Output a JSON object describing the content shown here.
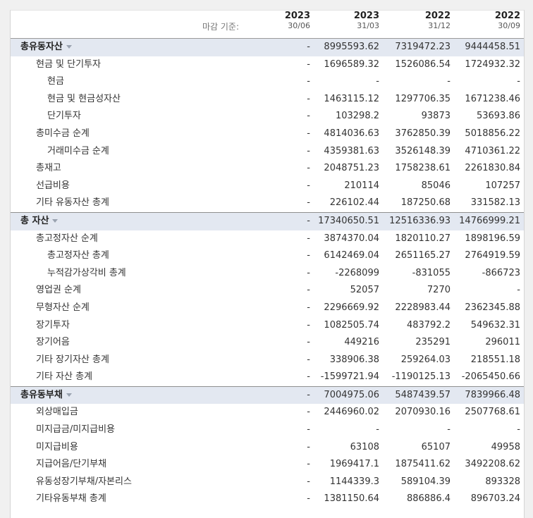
{
  "header": {
    "basis_label": "마감 기준:",
    "columns": [
      {
        "year": "2023",
        "date": "30/06"
      },
      {
        "year": "2023",
        "date": "31/03"
      },
      {
        "year": "2022",
        "date": "31/12"
      },
      {
        "year": "2022",
        "date": "30/09"
      }
    ]
  },
  "rows": [
    {
      "label": "총유동자산",
      "level": 0,
      "section": true,
      "values": [
        "-",
        "8995593.62",
        "7319472.23",
        "9444458.51"
      ]
    },
    {
      "label": "현금 및 단기투자",
      "level": 1,
      "values": [
        "-",
        "1696589.32",
        "1526086.54",
        "1724932.32"
      ]
    },
    {
      "label": "현금",
      "level": 2,
      "values": [
        "-",
        "-",
        "-",
        "-"
      ]
    },
    {
      "label": "현금 및 현금성자산",
      "level": 2,
      "values": [
        "-",
        "1463115.12",
        "1297706.35",
        "1671238.46"
      ]
    },
    {
      "label": "단기투자",
      "level": 2,
      "values": [
        "-",
        "103298.2",
        "93873",
        "53693.86"
      ]
    },
    {
      "label": "총미수금 순계",
      "level": 1,
      "values": [
        "-",
        "4814036.63",
        "3762850.39",
        "5018856.22"
      ]
    },
    {
      "label": "거래미수금 순계",
      "level": 2,
      "values": [
        "-",
        "4359381.63",
        "3526148.39",
        "4710361.22"
      ]
    },
    {
      "label": "총재고",
      "level": 1,
      "values": [
        "-",
        "2048751.23",
        "1758238.61",
        "2261830.84"
      ]
    },
    {
      "label": "선급비용",
      "level": 1,
      "values": [
        "-",
        "210114",
        "85046",
        "107257"
      ]
    },
    {
      "label": "기타 유동자산 총계",
      "level": 1,
      "values": [
        "-",
        "226102.44",
        "187250.68",
        "331582.13"
      ]
    },
    {
      "label": "총 자산",
      "level": 0,
      "section": true,
      "values": [
        "-",
        "17340650.51",
        "12516336.93",
        "14766999.21"
      ]
    },
    {
      "label": "총고정자산 순계",
      "level": 1,
      "values": [
        "-",
        "3874370.04",
        "1820110.27",
        "1898196.59"
      ]
    },
    {
      "label": "총고정자산 총계",
      "level": 2,
      "values": [
        "-",
        "6142469.04",
        "2651165.27",
        "2764919.59"
      ]
    },
    {
      "label": "누적감가상각비 총계",
      "level": 2,
      "values": [
        "-",
        "-2268099",
        "-831055",
        "-866723"
      ]
    },
    {
      "label": "영업권 순계",
      "level": 1,
      "values": [
        "-",
        "52057",
        "7270",
        "-"
      ]
    },
    {
      "label": "무형자산 순계",
      "level": 1,
      "values": [
        "-",
        "2296669.92",
        "2228983.44",
        "2362345.88"
      ]
    },
    {
      "label": "장기투자",
      "level": 1,
      "values": [
        "-",
        "1082505.74",
        "483792.2",
        "549632.31"
      ]
    },
    {
      "label": "장기어음",
      "level": 1,
      "values": [
        "-",
        "449216",
        "235291",
        "296011"
      ]
    },
    {
      "label": "기타 장기자산 총계",
      "level": 1,
      "values": [
        "-",
        "338906.38",
        "259264.03",
        "218551.18"
      ]
    },
    {
      "label": "기타 자산 총계",
      "level": 1,
      "values": [
        "-",
        "-1599721.94",
        "-1190125.13",
        "-2065450.66"
      ]
    },
    {
      "label": "총유동부채",
      "level": 0,
      "section": true,
      "values": [
        "-",
        "7004975.06",
        "5487439.57",
        "7839966.48"
      ]
    },
    {
      "label": "외상매입금",
      "level": 1,
      "values": [
        "-",
        "2446960.02",
        "2070930.16",
        "2507768.61"
      ]
    },
    {
      "label": "미지급금/미지급비용",
      "level": 1,
      "values": [
        "-",
        "-",
        "-",
        "-"
      ]
    },
    {
      "label": "미지급비용",
      "level": 1,
      "values": [
        "-",
        "63108",
        "65107",
        "49958"
      ]
    },
    {
      "label": "지급어음/단기부채",
      "level": 1,
      "values": [
        "-",
        "1969417.1",
        "1875411.62",
        "3492208.62"
      ]
    },
    {
      "label": "유동성장기부채/자본리스",
      "level": 1,
      "values": [
        "-",
        "1144339.3",
        "589104.39",
        "893328"
      ]
    },
    {
      "label": "기타유동부채 총계",
      "level": 1,
      "values": [
        "-",
        "1381150.64",
        "886886.4",
        "896703.24"
      ]
    }
  ]
}
